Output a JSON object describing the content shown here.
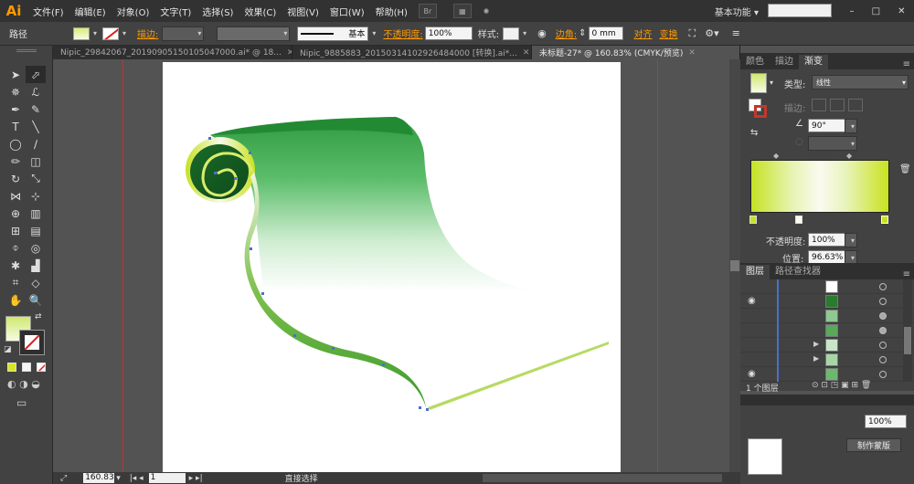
{
  "app": {
    "logo": "Ai"
  },
  "menu": {
    "items": [
      "文件(F)",
      "编辑(E)",
      "对象(O)",
      "文字(T)",
      "选择(S)",
      "效果(C)",
      "视图(V)",
      "窗口(W)",
      "帮助(H)"
    ],
    "workspace": "基本功能",
    "workspace_arrow": "▾"
  },
  "control": {
    "label": "路径",
    "stroke_label": "描边:",
    "stroke_style": "基本",
    "opacity_label": "不透明度:",
    "opacity_value": "100%",
    "style_label": "样式:",
    "corner_label": "边角:",
    "corner_value": "0 mm",
    "align_label": "对齐",
    "transform_label": "变换"
  },
  "tabs": [
    {
      "label": "Nipic_29842067_20190905150105047000.ai* @ 18...",
      "active": false
    },
    {
      "label": "Nipic_9885883_20150314102926484000 [转换].ai*...",
      "active": false
    },
    {
      "label": "未标题-27* @ 160.83% (CMYK/预览)",
      "active": true
    }
  ],
  "gradient_panel": {
    "tabs": [
      "颜色",
      "描边",
      "渐变"
    ],
    "type_label": "类型:",
    "type_value": "线性",
    "stroke_label": "描边:",
    "angle_value": "90°",
    "opacity_label": "不透明度:",
    "opacity_value": "100%",
    "position_label": "位置:",
    "position_value": "96.63%"
  },
  "layers_panel": {
    "tabs": [
      "图层",
      "路径查找器"
    ],
    "footer": "1 个图层"
  },
  "transparency_panel": {
    "opacity_value": "100%",
    "make_mask_label": "制作蒙版"
  },
  "status": {
    "zoom": "160.83",
    "page": "1",
    "tool_label": "直接选择"
  },
  "colors": {
    "scroll_dark": "#1f6e2a",
    "scroll_mid": "#36a048",
    "stroke_lime": "#a9d44a"
  }
}
